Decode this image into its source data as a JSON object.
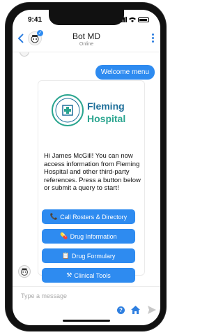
{
  "status_bar": {
    "time": "9:41"
  },
  "header": {
    "bot_name": "Bot MD",
    "status": "Online"
  },
  "messages": {
    "user_message": "Welcome menu"
  },
  "card": {
    "logo_line1": "Fleming",
    "logo_line2": "Hospital",
    "intro": "Hi James McGill!  You can now access information from Fleming Hospital and other third-party references. Press a button below or submit a query to start!",
    "buttons": [
      {
        "icon": "📞",
        "label": "Call Rosters & Directory"
      },
      {
        "icon": "💊",
        "label": "Drug Information"
      },
      {
        "icon": "📋",
        "label": "Drug Formulary"
      },
      {
        "icon": "⚒",
        "label": "Clinical Tools"
      }
    ]
  },
  "composer": {
    "placeholder": "Type a message"
  },
  "colors": {
    "accent": "#2e8bf0",
    "logo_blue": "#1e6f9a",
    "logo_green": "#2aa58f"
  }
}
